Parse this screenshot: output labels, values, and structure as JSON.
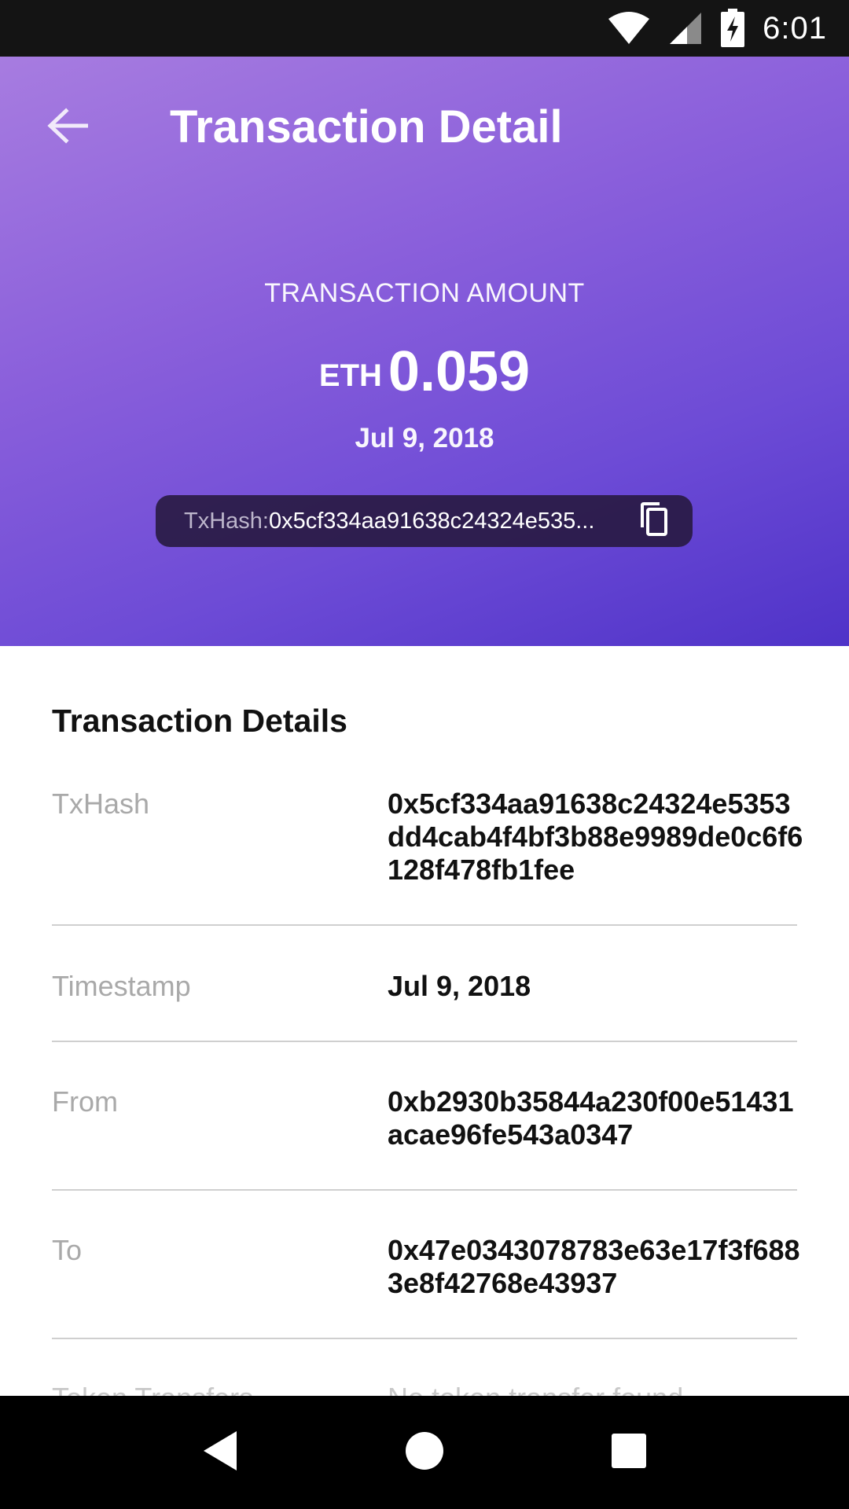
{
  "status_bar": {
    "time": "6:01",
    "icons": [
      "wifi-icon",
      "cell-signal-icon",
      "battery-charging-icon"
    ]
  },
  "toolbar": {
    "title": "Transaction Detail",
    "back_icon": "arrow-left-icon"
  },
  "hero": {
    "amount_label": "TRANSACTION AMOUNT",
    "amount_unit": "ETH",
    "amount_value": "0.059",
    "date": "Jul 9, 2018",
    "txhash_label": "TxHash:",
    "txhash_value": "0x5cf334aa91638c24324e535...",
    "copy_icon": "copy-icon"
  },
  "details": {
    "title": "Transaction Details",
    "rows": [
      {
        "label": "TxHash",
        "value": "0x5cf334aa91638c24324e5353dd4cab4f4bf3b88e9989de0c6f6128f478fb1fee"
      },
      {
        "label": "Timestamp",
        "value": "Jul 9, 2018"
      },
      {
        "label": "From",
        "value": "0xb2930b35844a230f00e51431acae96fe543a0347"
      },
      {
        "label": "To",
        "value": "0x47e0343078783e63e17f3f6883e8f42768e43937"
      },
      {
        "label": "Token Transfers",
        "value": "No token transfer found"
      }
    ]
  },
  "nav_bar": {
    "icons": [
      "back-triangle-icon",
      "home-circle-icon",
      "recents-square-icon"
    ]
  }
}
